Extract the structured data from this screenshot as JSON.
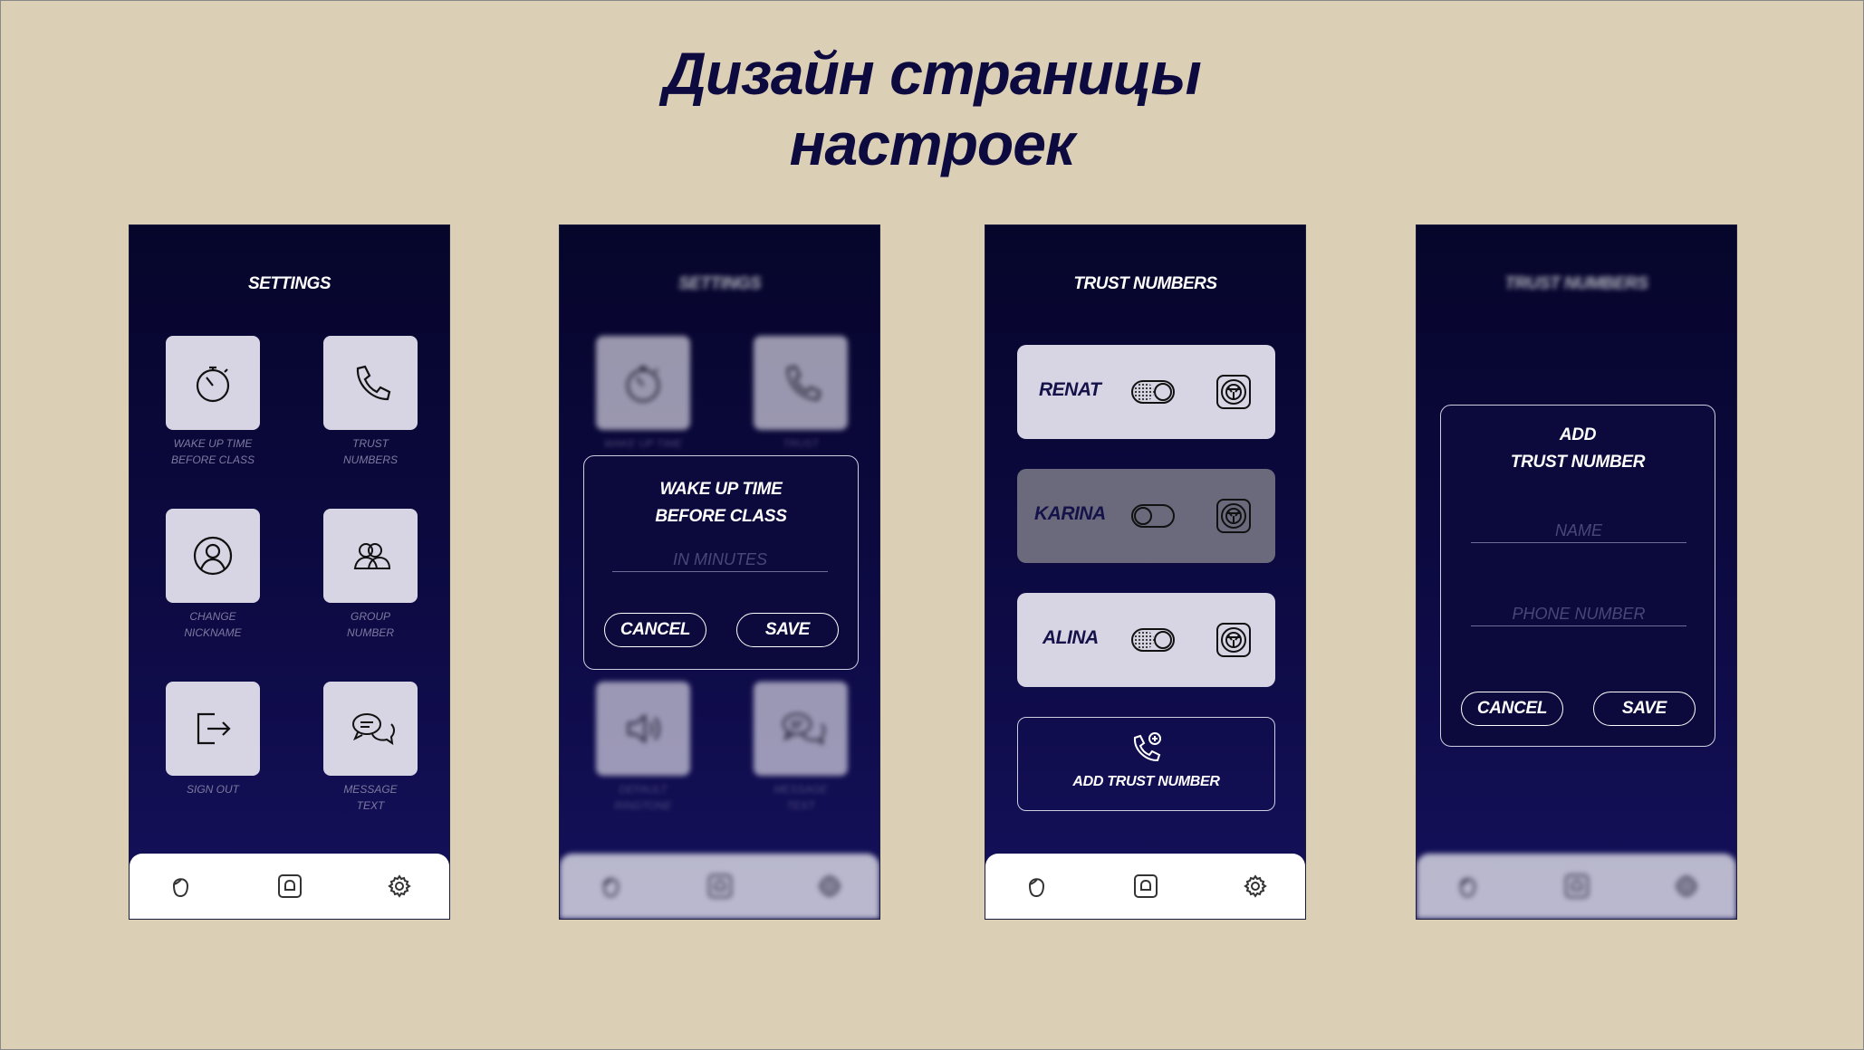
{
  "title": {
    "line1": "Дизайн страницы",
    "line2": "настроек"
  },
  "screens": [
    {
      "header": "SETTINGS",
      "tiles": [
        {
          "icon": "stopwatch-icon",
          "label1": "WAKE UP TIME",
          "label2": "BEFORE CLASS"
        },
        {
          "icon": "phone-icon",
          "label1": "TRUST",
          "label2": "NUMBERS"
        },
        {
          "icon": "user-circle-icon",
          "label1": "CHANGE",
          "label2": "NICKNAME"
        },
        {
          "icon": "group-icon",
          "label1": "GROUP",
          "label2": "NUMBER"
        },
        {
          "icon": "sign-out-icon",
          "label1": "SIGN OUT",
          "label2": ""
        },
        {
          "icon": "chat-icon",
          "label1": "MESSAGE",
          "label2": "TEXT"
        }
      ]
    },
    {
      "header": "SETTINGS",
      "tiles": [
        {
          "icon": "stopwatch-icon",
          "label1": "WAKE UP TIME"
        },
        {
          "icon": "phone-icon",
          "label1": "TRUST"
        },
        {
          "icon": "speaker-icon",
          "label1": "DEFAULT",
          "label2": "RINGTONE"
        },
        {
          "icon": "chat-icon",
          "label1": "MESSAGE",
          "label2": "TEXT"
        }
      ],
      "dialog": {
        "title1": "WAKE UP TIME",
        "title2": "BEFORE CLASS",
        "placeholder": "IN MINUTES",
        "cancel": "CANCEL",
        "save": "SAVE"
      }
    },
    {
      "header": "TRUST NUMBERS",
      "contacts": [
        {
          "name": "RENAT",
          "enabled": true
        },
        {
          "name": "KARINA",
          "enabled": false
        },
        {
          "name": "ALINA",
          "enabled": true
        }
      ],
      "add_label": "ADD TRUST NUMBER"
    },
    {
      "header": "TRUST NUMBERS",
      "dialog": {
        "title1": "ADD",
        "title2": "TRUST NUMBER",
        "name_placeholder": "NAME",
        "phone_placeholder": "PHONE NUMBER",
        "cancel": "CANCEL",
        "save": "SAVE"
      }
    }
  ],
  "nav": {
    "icons": [
      "face-icon",
      "bell-icon",
      "gear-icon"
    ]
  },
  "colors": {
    "background": "#dbcfb6",
    "screen": "#0d0a44",
    "tile": "#d7d4e3",
    "title": "#0c0a3e"
  }
}
